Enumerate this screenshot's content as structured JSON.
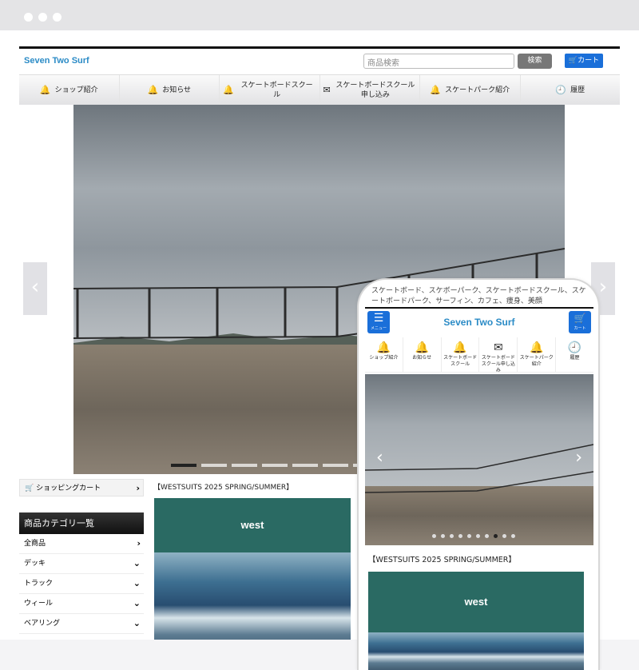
{
  "site": {
    "logo": "Seven Two Surf",
    "search_placeholder": "商品検索",
    "search_button": "検索",
    "cart_button": "カート"
  },
  "nav": [
    {
      "label": "ショップ紹介",
      "icon": "bell-icon"
    },
    {
      "label": "お知らせ",
      "icon": "bell-icon"
    },
    {
      "label": "スケートボードスクール",
      "icon": "bell-icon"
    },
    {
      "label": "スケートボードスクール申し込み",
      "icon": "envelope-icon"
    },
    {
      "label": "スケートパーク紹介",
      "icon": "bell-icon"
    },
    {
      "label": "履歴",
      "icon": "clock-icon"
    }
  ],
  "sidebar": {
    "cart_label": "ショッピングカート",
    "category_title": "商品カテゴリ一覧",
    "categories": [
      {
        "label": "全商品",
        "chevron": "right"
      },
      {
        "label": "デッキ",
        "chevron": "down"
      },
      {
        "label": "トラック",
        "chevron": "down"
      },
      {
        "label": "ウィール",
        "chevron": "down"
      },
      {
        "label": "ベアリング",
        "chevron": "down"
      }
    ]
  },
  "news": {
    "title": "【WESTSUITS 2025 SPRING/SUMMER】",
    "brand_text": "west"
  },
  "phone": {
    "tagline": "スケートボード、スケボーパーク、スケートボードスクール、スケートボードパーク、サーフィン、カフェ、痩身、美顔",
    "menu_label": "メニュー",
    "logo": "Seven Two Surf",
    "cart_label": "カート",
    "nav": [
      {
        "label": "ショップ紹介",
        "icon": "bell-icon"
      },
      {
        "label": "お知らせ",
        "icon": "bell-icon"
      },
      {
        "label": "スケートボードスクール",
        "icon": "bell-icon"
      },
      {
        "label": "スケートボードスクール申し込み",
        "icon": "envelope-icon"
      },
      {
        "label": "スケートパーク紹介",
        "icon": "bell-icon"
      },
      {
        "label": "履歴",
        "icon": "clock-icon"
      }
    ],
    "news_title": "【WESTSUITS 2025 SPRING/SUMMER】",
    "brand_text": "west"
  },
  "slider": {
    "slide_count": 7,
    "active_index": 0,
    "phone_slide_count": 10,
    "phone_active_index": 7
  },
  "colors": {
    "accent_blue": "#1a6fd9",
    "logo_blue": "#2b8bc6",
    "banner_green": "#2a6a63"
  }
}
